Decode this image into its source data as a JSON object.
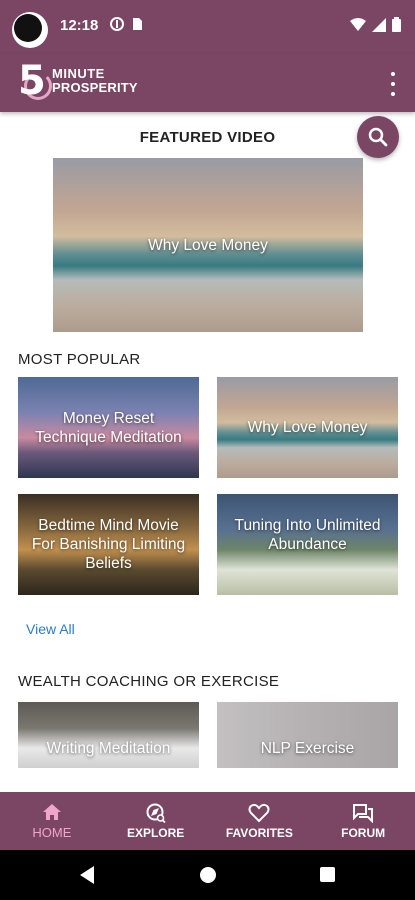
{
  "status_bar": {
    "time": "12:18"
  },
  "app_bar": {
    "logo_number": "5",
    "logo_line1": "MINUTE",
    "logo_line2": "PROSPERITY"
  },
  "featured": {
    "section_title": "FEATURED VIDEO",
    "video_title": "Why Love Money"
  },
  "most_popular": {
    "section_title": "MOST POPULAR",
    "items": [
      {
        "title": "Money Reset Technique Meditation"
      },
      {
        "title": "Why Love Money"
      },
      {
        "title": "Bedtime Mind Movie For Banishing Limiting Beliefs"
      },
      {
        "title": "Tuning Into Unlimited Abundance"
      }
    ],
    "view_all_label": "View All"
  },
  "wealth_coaching": {
    "section_title": "WEALTH COACHING OR EXERCISE",
    "items": [
      {
        "title": "Writing Meditation"
      },
      {
        "title": "NLP Exercise"
      }
    ]
  },
  "bottom_nav": {
    "items": [
      {
        "label": "HOME",
        "icon": "home-icon",
        "active": true
      },
      {
        "label": "EXPLORE",
        "icon": "explore-icon",
        "active": false
      },
      {
        "label": "FAVORITES",
        "icon": "heart-icon",
        "active": false
      },
      {
        "label": "FORUM",
        "icon": "forum-icon",
        "active": false
      }
    ]
  },
  "colors": {
    "brand": "#7a4664",
    "active_nav": "#f0a6c8",
    "link": "#2a7bd1"
  }
}
